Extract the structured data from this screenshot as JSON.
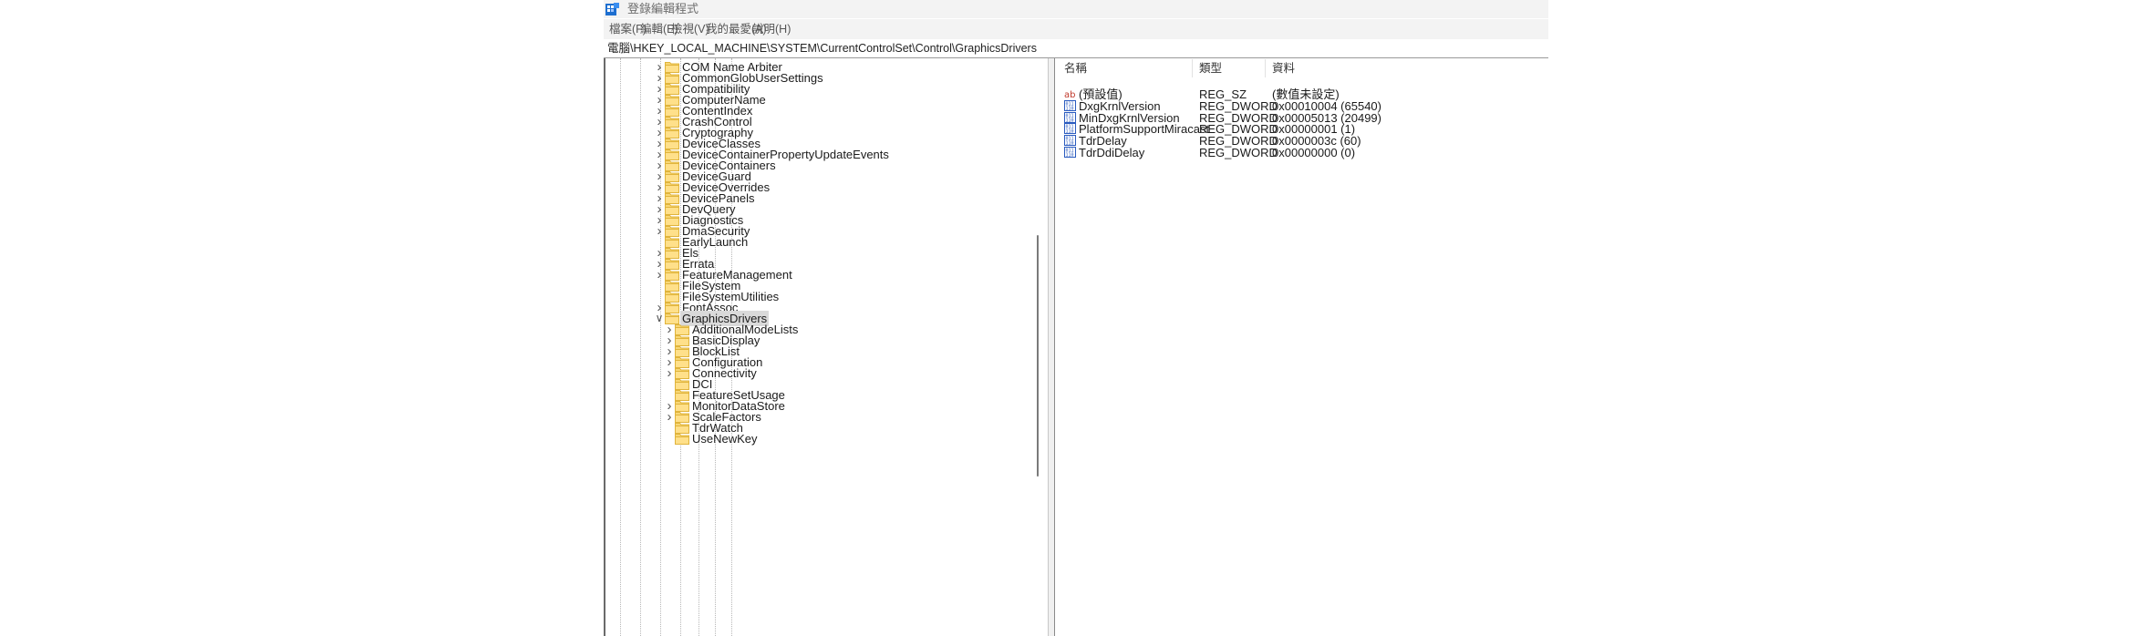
{
  "window": {
    "title": "登錄編輯程式",
    "icon": "regedit-icon"
  },
  "menu": [
    {
      "label": "檔案(F)",
      "name": "menu-file"
    },
    {
      "label": "編輯(E)",
      "name": "menu-edit"
    },
    {
      "label": "檢視(V)",
      "name": "menu-view"
    },
    {
      "label": "我的最愛(A)",
      "name": "menu-favorites"
    },
    {
      "label": "說明(H)",
      "name": "menu-help"
    }
  ],
  "address": "電腦\\HKEY_LOCAL_MACHINE\\SYSTEM\\CurrentControlSet\\Control\\GraphicsDrivers",
  "tree": {
    "level1": [
      {
        "label": "COM Name Arbiter",
        "expandable": true
      },
      {
        "label": "CommonGlobUserSettings",
        "expandable": true
      },
      {
        "label": "Compatibility",
        "expandable": true
      },
      {
        "label": "ComputerName",
        "expandable": true
      },
      {
        "label": "ContentIndex",
        "expandable": true
      },
      {
        "label": "CrashControl",
        "expandable": true
      },
      {
        "label": "Cryptography",
        "expandable": true
      },
      {
        "label": "DeviceClasses",
        "expandable": true
      },
      {
        "label": "DeviceContainerPropertyUpdateEvents",
        "expandable": true
      },
      {
        "label": "DeviceContainers",
        "expandable": true
      },
      {
        "label": "DeviceGuard",
        "expandable": true
      },
      {
        "label": "DeviceOverrides",
        "expandable": true
      },
      {
        "label": "DevicePanels",
        "expandable": true
      },
      {
        "label": "DevQuery",
        "expandable": true
      },
      {
        "label": "Diagnostics",
        "expandable": true
      },
      {
        "label": "DmaSecurity",
        "expandable": true
      },
      {
        "label": "EarlyLaunch",
        "expandable": false
      },
      {
        "label": "Els",
        "expandable": true
      },
      {
        "label": "Errata",
        "expandable": true
      },
      {
        "label": "FeatureManagement",
        "expandable": true
      },
      {
        "label": "FileSystem",
        "expandable": false
      },
      {
        "label": "FileSystemUtilities",
        "expandable": false
      },
      {
        "label": "FontAssoc",
        "expandable": true
      },
      {
        "label": "GraphicsDrivers",
        "expandable": true,
        "expanded": true,
        "selected": true
      }
    ],
    "level2": [
      {
        "label": "AdditionalModeLists",
        "expandable": true
      },
      {
        "label": "BasicDisplay",
        "expandable": true
      },
      {
        "label": "BlockList",
        "expandable": true
      },
      {
        "label": "Configuration",
        "expandable": true
      },
      {
        "label": "Connectivity",
        "expandable": true
      },
      {
        "label": "DCI",
        "expandable": false
      },
      {
        "label": "FeatureSetUsage",
        "expandable": false
      },
      {
        "label": "MonitorDataStore",
        "expandable": true
      },
      {
        "label": "ScaleFactors",
        "expandable": true
      },
      {
        "label": "TdrWatch",
        "expandable": false
      },
      {
        "label": "UseNewKey",
        "expandable": false
      }
    ]
  },
  "list": {
    "columns": {
      "name": "名稱",
      "type": "類型",
      "data": "資料"
    },
    "rows": [
      {
        "icon": "string-value-icon",
        "name": "(預設值)",
        "type": "REG_SZ",
        "data": "(數值未設定)"
      },
      {
        "icon": "binary-value-icon",
        "name": "DxgKrnlVersion",
        "type": "REG_DWORD",
        "data": "0x00010004 (65540)"
      },
      {
        "icon": "binary-value-icon",
        "name": "MinDxgKrnlVersion",
        "type": "REG_DWORD",
        "data": "0x00005013 (20499)"
      },
      {
        "icon": "binary-value-icon",
        "name": "PlatformSupportMiracast",
        "type": "REG_DWORD",
        "data": "0x00000001 (1)"
      },
      {
        "icon": "binary-value-icon",
        "name": "TdrDelay",
        "type": "REG_DWORD",
        "data": "0x0000003c (60)"
      },
      {
        "icon": "binary-value-icon",
        "name": "TdrDdiDelay",
        "type": "REG_DWORD",
        "data": "0x00000000 (0)"
      }
    ]
  },
  "colors": {
    "folder": "#F8D775",
    "folder_edge": "#E0B43C",
    "selection": "#D9D9D9",
    "chrome": "#F3F3F3"
  }
}
